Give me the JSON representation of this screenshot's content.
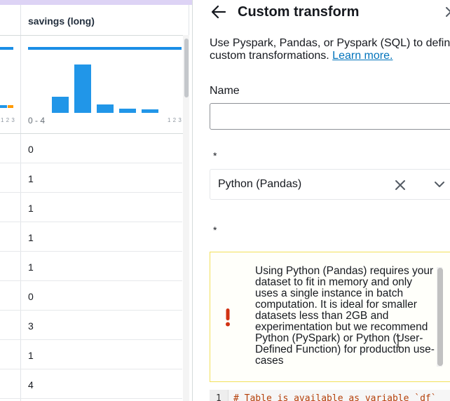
{
  "grid": {
    "column_header": "savings (long)",
    "histogram": {
      "range_label": "0 - 4",
      "axis_tiny_label": "1 2 3",
      "left_axis_tiny_label": "1 2 3",
      "bar_levels": [
        0.33,
        1.0,
        0.17,
        0.09,
        0.07
      ]
    },
    "rows": [
      "0",
      "1",
      "1",
      "1",
      "1",
      "0",
      "3",
      "1",
      "4"
    ]
  },
  "panel": {
    "title": "Custom transform",
    "description": "Use Pyspark, Pandas, or Pyspark (SQL) to define custom transformations. ",
    "learn_more": "Learn more.",
    "name_label": "Name",
    "name_value": "",
    "required_mark_1": "*",
    "required_mark_2": "*",
    "select_value": "Python (Pandas)",
    "alert_text": "Using Python (Pandas) requires your dataset to fit in memory and only uses a single instance in batch computation. It is ideal for smaller datasets less than 2GB and experimentation but we recommend Python (PySpark) or Python (User-Defined Function) for production use-cases",
    "code_line_number": "1",
    "code_line": "# Table is available as variable `df`"
  },
  "colors": {
    "accent": "#ddd3f5",
    "histogram_blue": "#2196e8",
    "alert_border": "#f2e15a",
    "alert_icon": "#d13212",
    "link": "#0073bb",
    "orange_mark": "#ff9900"
  }
}
